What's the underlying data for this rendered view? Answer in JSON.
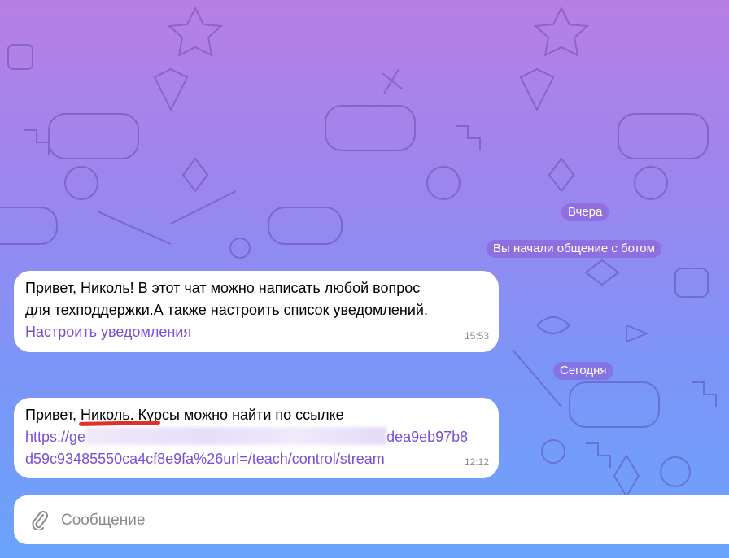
{
  "chat": {
    "date_yesterday": "Вчера",
    "service_message": "Вы начали общение с ботом",
    "date_today": "Сегодня",
    "messages": [
      {
        "lines": [
          "Привет, Николь! В этот чат можно написать любой вопрос",
          "для техподдержки.А также настроить список уведомлений."
        ],
        "link_text": "Настроить уведомления",
        "time": "15:53"
      },
      {
        "text": "Привет, Николь. Курсы можно найти по ссылке",
        "link_start": "https://ge",
        "link_mid_end": "dea9eb97b8",
        "link_line2": "d59c93485550ca4cf8e9fa%26url=/teach/control/stream",
        "time": "12:12"
      }
    ]
  },
  "composer": {
    "placeholder": "Сообщение",
    "attach_icon": "paperclip-icon"
  },
  "colors": {
    "bg_top": "#b77fe6",
    "bg_bottom": "#6aa3fb",
    "link": "#7a4fd6",
    "annotation": "#e0302a"
  }
}
